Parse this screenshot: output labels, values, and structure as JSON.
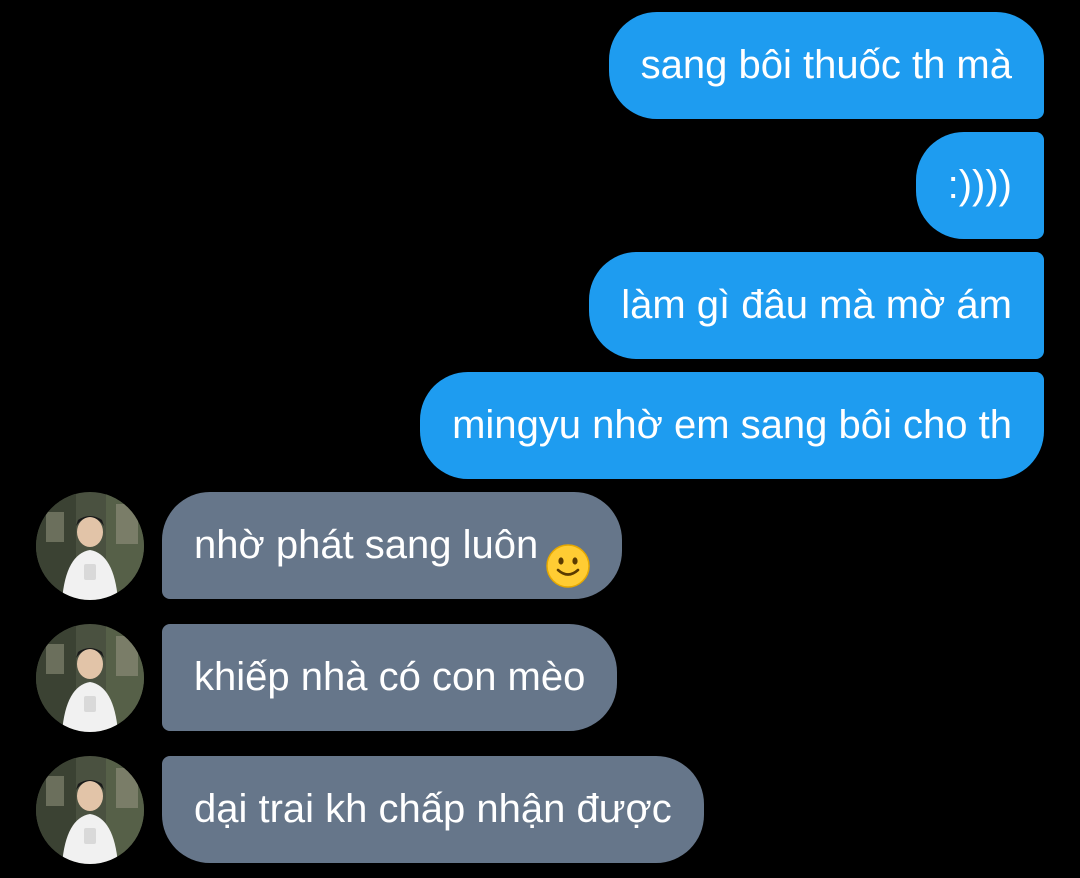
{
  "messages": {
    "sent": [
      {
        "text": "sang bôi thuốc th mà"
      },
      {
        "text": ":))))"
      },
      {
        "text": "làm gì đâu mà mờ ám"
      },
      {
        "text": "mingyu nhờ em sang bôi cho th"
      }
    ],
    "received": [
      {
        "text": "nhờ phát sang luôn",
        "emoji_icon": "slightly-smiling-face-icon"
      },
      {
        "text": "khiếp nhà có con mèo"
      },
      {
        "text": "dại trai kh chấp nhận được"
      }
    ]
  },
  "colors": {
    "background": "#000000",
    "sent_bubble": "#1e9cf0",
    "received_bubble": "#66768a",
    "text": "#ffffff"
  }
}
